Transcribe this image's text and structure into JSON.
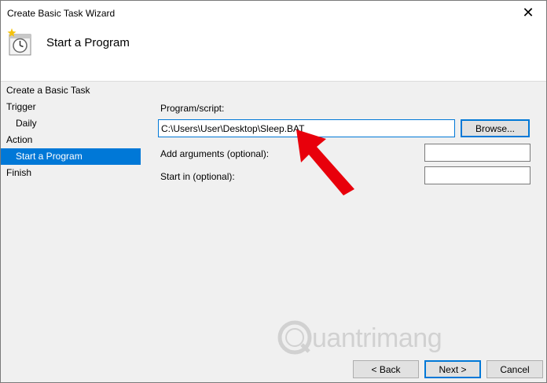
{
  "window": {
    "title": "Create Basic Task Wizard",
    "close_glyph": "✕"
  },
  "header": {
    "title": "Start a Program",
    "icon": "task-scheduler-icon"
  },
  "steps": [
    {
      "label": "Create a Basic Task"
    },
    {
      "label": "Trigger"
    },
    {
      "label": "Daily"
    },
    {
      "label": "Action"
    },
    {
      "label": "Start a Program"
    },
    {
      "label": "Finish"
    }
  ],
  "form": {
    "program_label": "Program/script:",
    "program_value": "C:\\Users\\User\\Desktop\\Sleep.BAT",
    "browse_label": "Browse...",
    "args_label": "Add arguments (optional):",
    "args_value": "",
    "start_in_label": "Start in (optional):",
    "start_in_value": ""
  },
  "buttons": {
    "back": "< Back",
    "next": "Next >",
    "cancel": "Cancel"
  },
  "watermark": {
    "text": "uantrimang"
  },
  "colors": {
    "accent": "#0078d7",
    "arrow": "#e8000b"
  }
}
